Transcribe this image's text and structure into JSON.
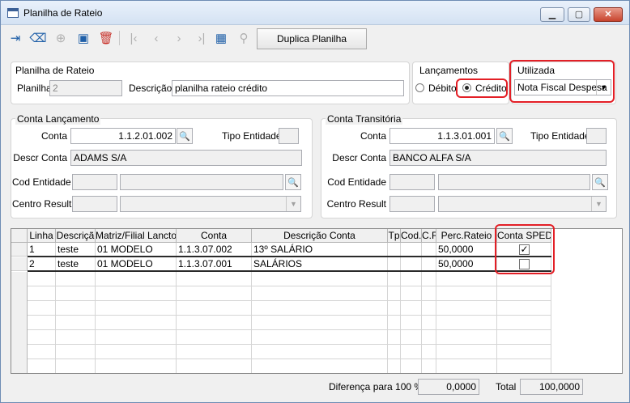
{
  "window": {
    "title": "Planilha de Rateio"
  },
  "toolbar": {
    "duplicate_label": "Duplica Planilha"
  },
  "header": {
    "group_title": "Planilha de Rateio",
    "planilha_label": "Planilha",
    "planilha_value": "2",
    "descricao_label": "Descrição",
    "descricao_value": "planilha rateio crédito"
  },
  "lancamentos": {
    "title": "Lançamentos",
    "debito_label": "Débito",
    "credito_label": "Crédito",
    "selected": "Crédito"
  },
  "utilizada": {
    "title": "Utilizada",
    "value": "Nota Fiscal Despesa"
  },
  "conta_lancamento": {
    "title": "Conta Lançamento",
    "conta_label": "Conta",
    "conta_value": "1.1.2.01.002",
    "tipo_entidade_label": "Tipo Entidade",
    "tipo_entidade_value": "",
    "descr_label": "Descr Conta",
    "descr_value": "ADAMS S/A",
    "cod_entidade_label": "Cod Entidade",
    "centro_label": "Centro Result"
  },
  "conta_transitoria": {
    "title": "Conta Transitória",
    "conta_label": "Conta",
    "conta_value": "1.1.3.01.001",
    "tipo_entidade_label": "Tipo Entidade",
    "tipo_entidade_value": "",
    "descr_label": "Descr Conta",
    "descr_value": "BANCO ALFA S/A",
    "cod_entidade_label": "Cod Entidade",
    "centro_label": "Centro Result"
  },
  "grid": {
    "columns": [
      "Linha",
      "Descriçã",
      "Matriz/Filial Lancto.",
      "Conta",
      "Descrição Conta",
      "Tp",
      "Cod.",
      "C.R",
      "Perc.Rateio",
      "Conta SPED"
    ],
    "rows": [
      {
        "linha": "1",
        "descricao": "teste",
        "matriz": "01 MODELO",
        "conta": "1.1.3.07.002",
        "descricao_conta": "13º SALÁRIO",
        "tp": "",
        "cod": "",
        "cr": "",
        "perc": "50,0000",
        "sped": true
      },
      {
        "linha": "2",
        "descricao": "teste",
        "matriz": "01 MODELO",
        "conta": "1.1.3.07.001",
        "descricao_conta": "SALÁRIOS",
        "tp": "",
        "cod": "",
        "cr": "",
        "perc": "50,0000",
        "sped": false
      }
    ]
  },
  "footer": {
    "diferenca_label": "Diferença para 100 %",
    "diferenca_value": "0,0000",
    "total_label": "Total",
    "total_value": "100,0000"
  },
  "icons": {
    "exit": "exit-icon",
    "eraser": "eraser-icon",
    "add": "add-icon",
    "save": "save-icon",
    "delete": "trash-icon",
    "first": "first-icon",
    "prev": "prev-icon",
    "next": "next-icon",
    "last": "last-icon",
    "grid": "grid-icon",
    "search": "search-icon"
  },
  "colors": {
    "highlight": "#e31f26",
    "accent": "#1f5fa8"
  }
}
